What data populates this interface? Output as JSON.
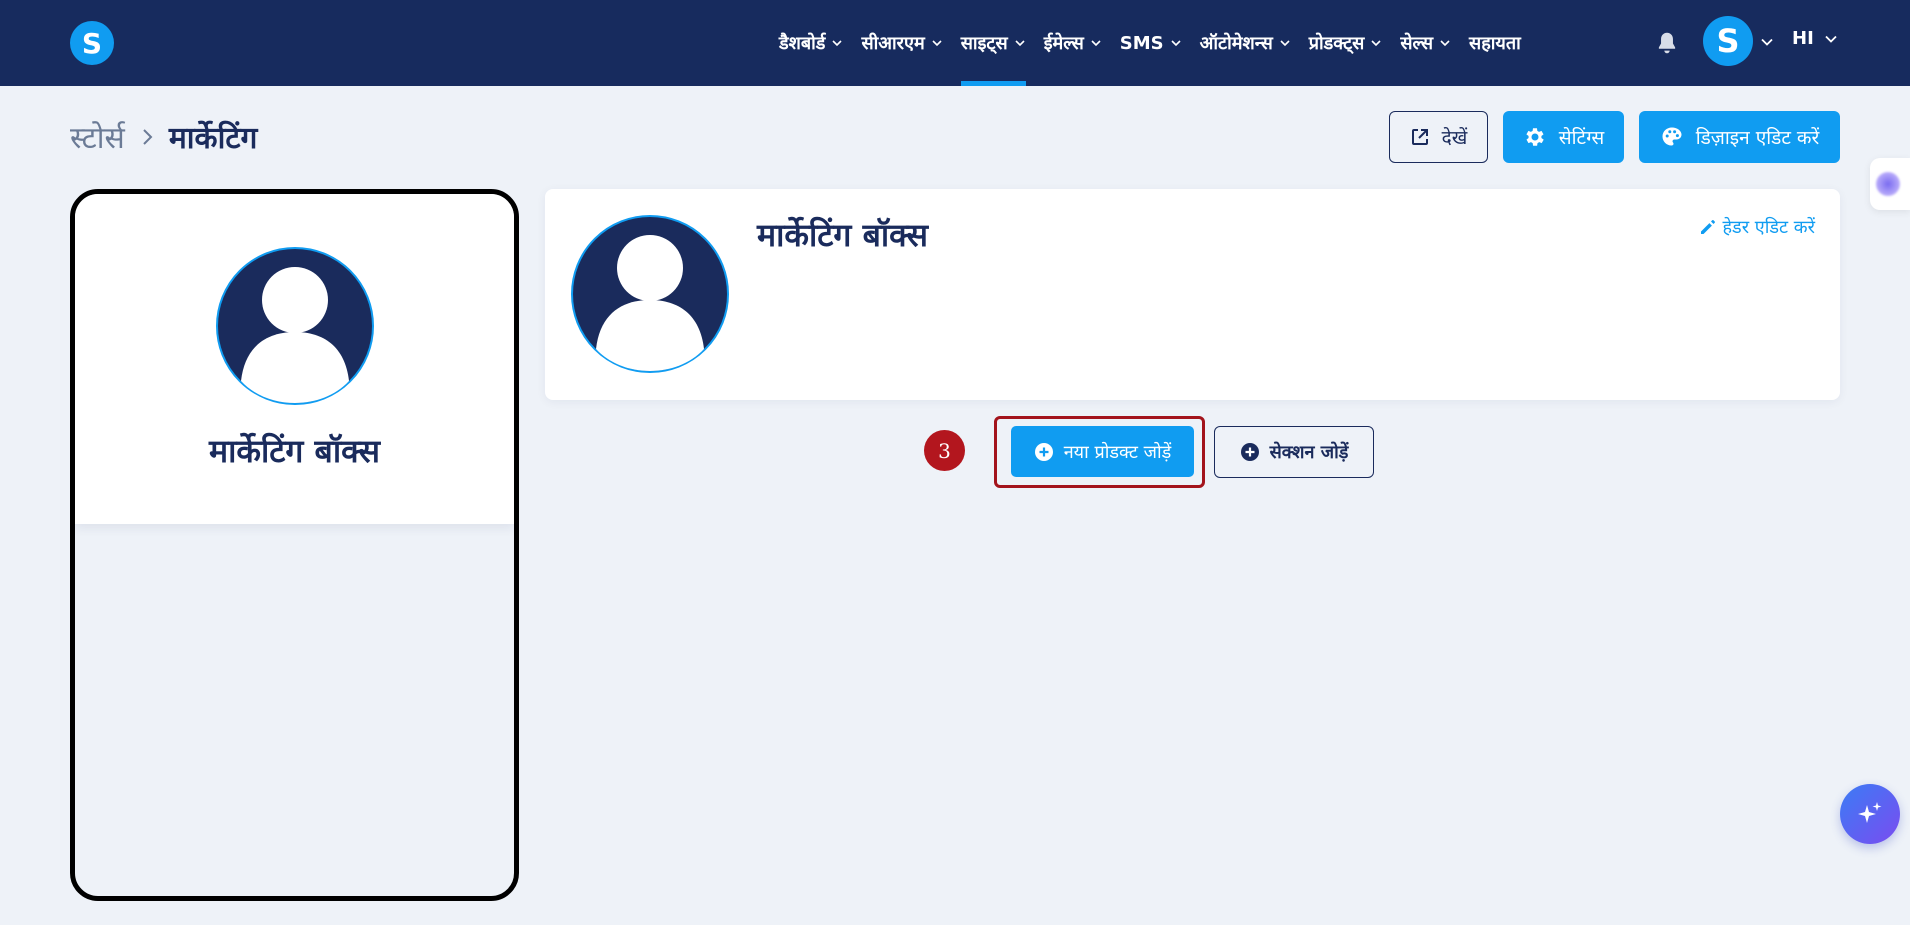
{
  "brand": {
    "logo_letter": "S"
  },
  "nav": {
    "items": [
      {
        "label": "डैशबोर्ड",
        "has_dropdown": true,
        "active": false
      },
      {
        "label": "सीआरएम",
        "has_dropdown": true,
        "active": false
      },
      {
        "label": "साइट्स",
        "has_dropdown": true,
        "active": true
      },
      {
        "label": "ईमेल्स",
        "has_dropdown": true,
        "active": false
      },
      {
        "label": "SMS",
        "has_dropdown": true,
        "active": false
      },
      {
        "label": "ऑटोमेशन्स",
        "has_dropdown": true,
        "active": false
      },
      {
        "label": "प्रोडक्ट्स",
        "has_dropdown": true,
        "active": false
      },
      {
        "label": "सेल्स",
        "has_dropdown": true,
        "active": false
      },
      {
        "label": "सहायता",
        "has_dropdown": false,
        "active": false
      }
    ],
    "avatar_letter": "S",
    "language": "HI"
  },
  "breadcrumb": {
    "parent": "स्टोर्स",
    "current": "मार्केटिंग"
  },
  "actions": {
    "view_label": "देखें",
    "settings_label": "सेटिंग्स",
    "design_label": "डिज़ाइन एडिट करें"
  },
  "preview": {
    "store_name": "मार्केटिंग बॉक्स"
  },
  "header_card": {
    "store_name": "मार्केटिंग बॉक्स",
    "edit_label": "हेडर एडिट करें"
  },
  "toolbar": {
    "step_number": "3",
    "add_product_label": "नया प्रोडक्ट जोड़ें",
    "add_section_label": "सेक्शन जोड़ें"
  },
  "colors": {
    "nav_bg": "#172b5e",
    "accent": "#109cf1",
    "highlight": "#a3141c",
    "text_dark": "#1a2b5c",
    "page_bg": "#eef2f8"
  }
}
